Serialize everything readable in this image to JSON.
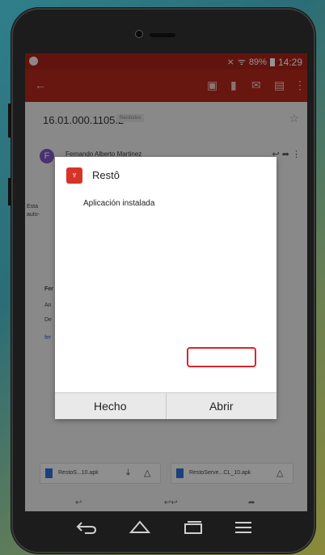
{
  "status_bar": {
    "battery": "89%",
    "time": "14:29"
  },
  "toolbar": {
    "icons": [
      "back-arrow-icon",
      "archive-icon",
      "delete-icon",
      "mail-icon",
      "move-icon",
      "more-vert-icon"
    ]
  },
  "email": {
    "subject": "16.01.000.1105.2",
    "label_chip": "Recibidos",
    "sender_initial": "F",
    "sender_name": "Fernando Alberto Martinez",
    "body_fragments": [
      "Esta",
      "auto-",
      "Fer",
      "An",
      "De",
      "fer"
    ]
  },
  "attachments": [
    {
      "name": "RestoS...10.apk"
    },
    {
      "name": "RestoServe...CL_10.apk"
    }
  ],
  "dialog": {
    "app_name": "Restô",
    "message": "Aplicación instalada",
    "button_done": "Hecho",
    "button_open": "Abrir"
  },
  "nav_bar": {
    "icons": [
      "back-icon",
      "home-icon",
      "recents-icon",
      "menu-icon"
    ]
  }
}
